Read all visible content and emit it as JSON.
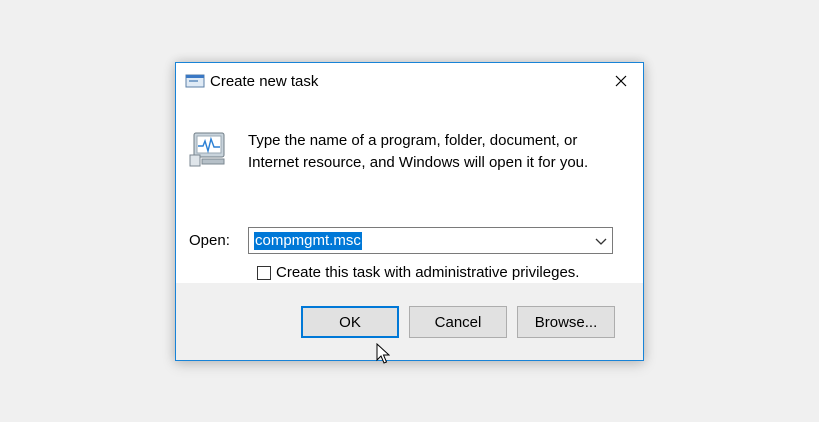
{
  "window": {
    "title": "Create new task"
  },
  "dialog": {
    "description_line1": "Type the name of a program, folder, document, or",
    "description_line2": "Internet resource, and Windows will open it for you.",
    "open_label": "Open:",
    "open_value": "compmgmt.msc",
    "admin_checkbox_label": "Create this task with administrative privileges.",
    "admin_checked": false
  },
  "buttons": {
    "ok": "OK",
    "cancel": "Cancel",
    "browse": "Browse..."
  },
  "icons": {
    "title": "run-task-icon",
    "program": "monitor-program-icon",
    "close": "close-icon",
    "dropdown": "chevron-down-icon",
    "cursor": "mouse-pointer-icon"
  },
  "colors": {
    "accent": "#0078d7",
    "window_border": "#1883d7",
    "footer_bg": "#f0f0f0"
  }
}
